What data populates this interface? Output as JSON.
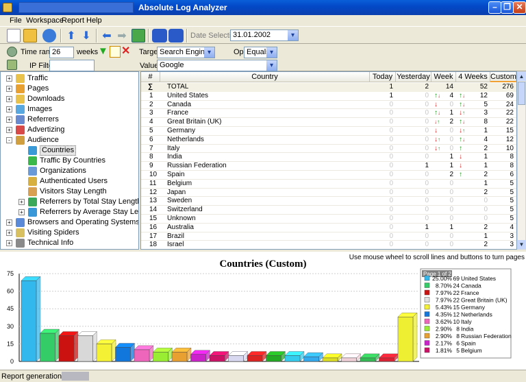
{
  "window": {
    "title": "Absolute Log Analyzer"
  },
  "menu": [
    "File",
    "Workspace",
    "Report",
    "Help"
  ],
  "toolbar": {
    "date_label": "Date Selection:",
    "date_value": "31.01.2002"
  },
  "filters": {
    "time_range_label": "Time range:",
    "time_range_value": "26",
    "time_range_unit": "weeks",
    "ip_filter_label": "IP Filter:",
    "ip_filter_value": "",
    "target_label": "Target:",
    "target_value": "Search Engine",
    "op_label": "Op.:",
    "op_value": "Equals",
    "value_label": "Value:",
    "value_value": "Google"
  },
  "tree": [
    {
      "label": "Traffic",
      "level": 0,
      "exp": "+"
    },
    {
      "label": "Pages",
      "level": 0,
      "exp": "+"
    },
    {
      "label": "Downloads",
      "level": 0,
      "exp": "+"
    },
    {
      "label": "Images",
      "level": 0,
      "exp": "+"
    },
    {
      "label": "Referrers",
      "level": 0,
      "exp": "+"
    },
    {
      "label": "Advertizing",
      "level": 0,
      "exp": "+"
    },
    {
      "label": "Audience",
      "level": 0,
      "exp": "-"
    },
    {
      "label": "Countries",
      "level": 1,
      "exp": "",
      "selected": true
    },
    {
      "label": "Traffic By Countries",
      "level": 1,
      "exp": ""
    },
    {
      "label": "Organizations",
      "level": 1,
      "exp": ""
    },
    {
      "label": "Authenticated Users",
      "level": 1,
      "exp": ""
    },
    {
      "label": "Visitors Stay Length",
      "level": 1,
      "exp": ""
    },
    {
      "label": "Referrers by Total Stay Length",
      "level": 1,
      "exp": "+"
    },
    {
      "label": "Referrers by Average Stay Length",
      "level": 1,
      "exp": "+"
    },
    {
      "label": "Browsers and Operating Systems",
      "level": 0,
      "exp": "+"
    },
    {
      "label": "Visiting Spiders",
      "level": 0,
      "exp": "+"
    },
    {
      "label": "Technical Info",
      "level": 0,
      "exp": "+"
    }
  ],
  "table": {
    "columns": [
      "#",
      "Country",
      "Today",
      "Yesterday",
      "Week",
      "4 Weeks",
      "Custom"
    ],
    "total": {
      "sigma": "∑",
      "label": "TOTAL",
      "today": "1",
      "yesterday": "2",
      "week": "14",
      "weeks4": "52",
      "custom": "276"
    },
    "rows": [
      {
        "n": "1",
        "country": "United States",
        "today": "1",
        "yesterday": "0",
        "week": "4",
        "week_t": "up2",
        "weeks4": "12",
        "weeks4_t": "up2",
        "custom": "69"
      },
      {
        "n": "2",
        "country": "Canada",
        "today": "0",
        "yesterday": "0",
        "week": "0",
        "week_t": "dn",
        "weeks4": "5",
        "weeks4_t": "up2",
        "custom": "24"
      },
      {
        "n": "3",
        "country": "France",
        "today": "0",
        "yesterday": "0",
        "week": "1",
        "week_t": "up2",
        "weeks4": "3",
        "weeks4_t": "dn2",
        "custom": "22"
      },
      {
        "n": "4",
        "country": "Great Britain (UK)",
        "today": "0",
        "yesterday": "0",
        "week": "2",
        "week_t": "eq",
        "weeks4": "8",
        "weeks4_t": "up2",
        "custom": "22"
      },
      {
        "n": "5",
        "country": "Germany",
        "today": "0",
        "yesterday": "0",
        "week": "0",
        "week_t": "dn",
        "weeks4": "1",
        "weeks4_t": "dn2",
        "custom": "15"
      },
      {
        "n": "6",
        "country": "Netherlands",
        "today": "0",
        "yesterday": "0",
        "week": "0",
        "week_t": "dn2",
        "weeks4": "4",
        "weeks4_t": "up2",
        "custom": "12"
      },
      {
        "n": "7",
        "country": "Italy",
        "today": "0",
        "yesterday": "0",
        "week": "0",
        "week_t": "dn2",
        "weeks4": "2",
        "weeks4_t": "up",
        "custom": "10"
      },
      {
        "n": "8",
        "country": "India",
        "today": "0",
        "yesterday": "0",
        "week": "1",
        "week_t": "",
        "weeks4": "1",
        "weeks4_t": "dn",
        "custom": "8"
      },
      {
        "n": "9",
        "country": "Russian Federation",
        "today": "0",
        "yesterday": "1",
        "week": "1",
        "week_t": "",
        "weeks4": "1",
        "weeks4_t": "dn",
        "custom": "8"
      },
      {
        "n": "10",
        "country": "Spain",
        "today": "0",
        "yesterday": "0",
        "week": "2",
        "week_t": "",
        "weeks4": "2",
        "weeks4_t": "up",
        "custom": "6"
      },
      {
        "n": "11",
        "country": "Belgium",
        "today": "0",
        "yesterday": "0",
        "week": "0",
        "week_t": "",
        "weeks4": "1",
        "weeks4_t": "",
        "custom": "5"
      },
      {
        "n": "12",
        "country": "Japan",
        "today": "0",
        "yesterday": "0",
        "week": "0",
        "week_t": "",
        "weeks4": "2",
        "weeks4_t": "",
        "custom": "5"
      },
      {
        "n": "13",
        "country": "Sweden",
        "today": "0",
        "yesterday": "0",
        "week": "0",
        "week_t": "",
        "weeks4": "0",
        "weeks4_t": "",
        "custom": "5"
      },
      {
        "n": "14",
        "country": "Switzerland",
        "today": "0",
        "yesterday": "0",
        "week": "0",
        "week_t": "",
        "weeks4": "0",
        "weeks4_t": "",
        "custom": "5"
      },
      {
        "n": "15",
        "country": "Unknown",
        "today": "0",
        "yesterday": "0",
        "week": "0",
        "week_t": "",
        "weeks4": "0",
        "weeks4_t": "",
        "custom": "5"
      },
      {
        "n": "16",
        "country": "Australia",
        "today": "0",
        "yesterday": "1",
        "week": "1",
        "week_t": "",
        "weeks4": "2",
        "weeks4_t": "",
        "custom": "4"
      },
      {
        "n": "17",
        "country": "Brazil",
        "today": "0",
        "yesterday": "0",
        "week": "0",
        "week_t": "",
        "weeks4": "1",
        "weeks4_t": "",
        "custom": "3"
      },
      {
        "n": "18",
        "country": "Israel",
        "today": "0",
        "yesterday": "0",
        "week": "0",
        "week_t": "",
        "weeks4": "2",
        "weeks4_t": "",
        "custom": "3"
      }
    ]
  },
  "chart_hint": "Use mouse wheel to scroll lines and buttons to turn pages",
  "chart_data": {
    "type": "bar",
    "title": "Countries (Custom)",
    "ylim": [
      0,
      75
    ],
    "yticks": [
      0,
      15,
      30,
      45,
      60,
      75
    ],
    "values": [
      69,
      24,
      22,
      22,
      15,
      12,
      10,
      8,
      8,
      6,
      5,
      5,
      5,
      5,
      5,
      4,
      3,
      3,
      3,
      3,
      38
    ],
    "colors": [
      "#33b8ee",
      "#33cc66",
      "#cc1111",
      "#d8d8d8",
      "#f4f033",
      "#1177dd",
      "#ee66bb",
      "#99ee33",
      "#e8a030",
      "#cc22cc",
      "#cc1166",
      "#d8d8f0",
      "#dd2222",
      "#22aa22",
      "#33ccee",
      "#33aaee",
      "#dddd22",
      "#f0d0d8",
      "#33bb55",
      "#dd2233",
      "#eeee33"
    ],
    "legend_page": "Page 1 of 2",
    "legend": [
      {
        "pct": "25.00%",
        "count": "69",
        "name": "United States",
        "color": "#33b8ee"
      },
      {
        "pct": "8.70%",
        "count": "24",
        "name": "Canada",
        "color": "#33cc66"
      },
      {
        "pct": "7.97%",
        "count": "22",
        "name": "France",
        "color": "#cc1111"
      },
      {
        "pct": "7.97%",
        "count": "22",
        "name": "Great Britain (UK)",
        "color": "#e0e0e0"
      },
      {
        "pct": "5.43%",
        "count": "15",
        "name": "Germany",
        "color": "#f4f033"
      },
      {
        "pct": "4.35%",
        "count": "12",
        "name": "Netherlands",
        "color": "#1177dd"
      },
      {
        "pct": "3.62%",
        "count": "10",
        "name": "Italy",
        "color": "#ee66bb"
      },
      {
        "pct": "2.90%",
        "count": "8",
        "name": "India",
        "color": "#99ee33"
      },
      {
        "pct": "2.90%",
        "count": "8",
        "name": "Russian Federation",
        "color": "#e8a030"
      },
      {
        "pct": "2.17%",
        "count": "6",
        "name": "Spain",
        "color": "#cc22cc"
      },
      {
        "pct": "1.81%",
        "count": "5",
        "name": "Belgium",
        "color": "#cc1166"
      }
    ]
  },
  "status": {
    "label": "Report generation time:"
  }
}
